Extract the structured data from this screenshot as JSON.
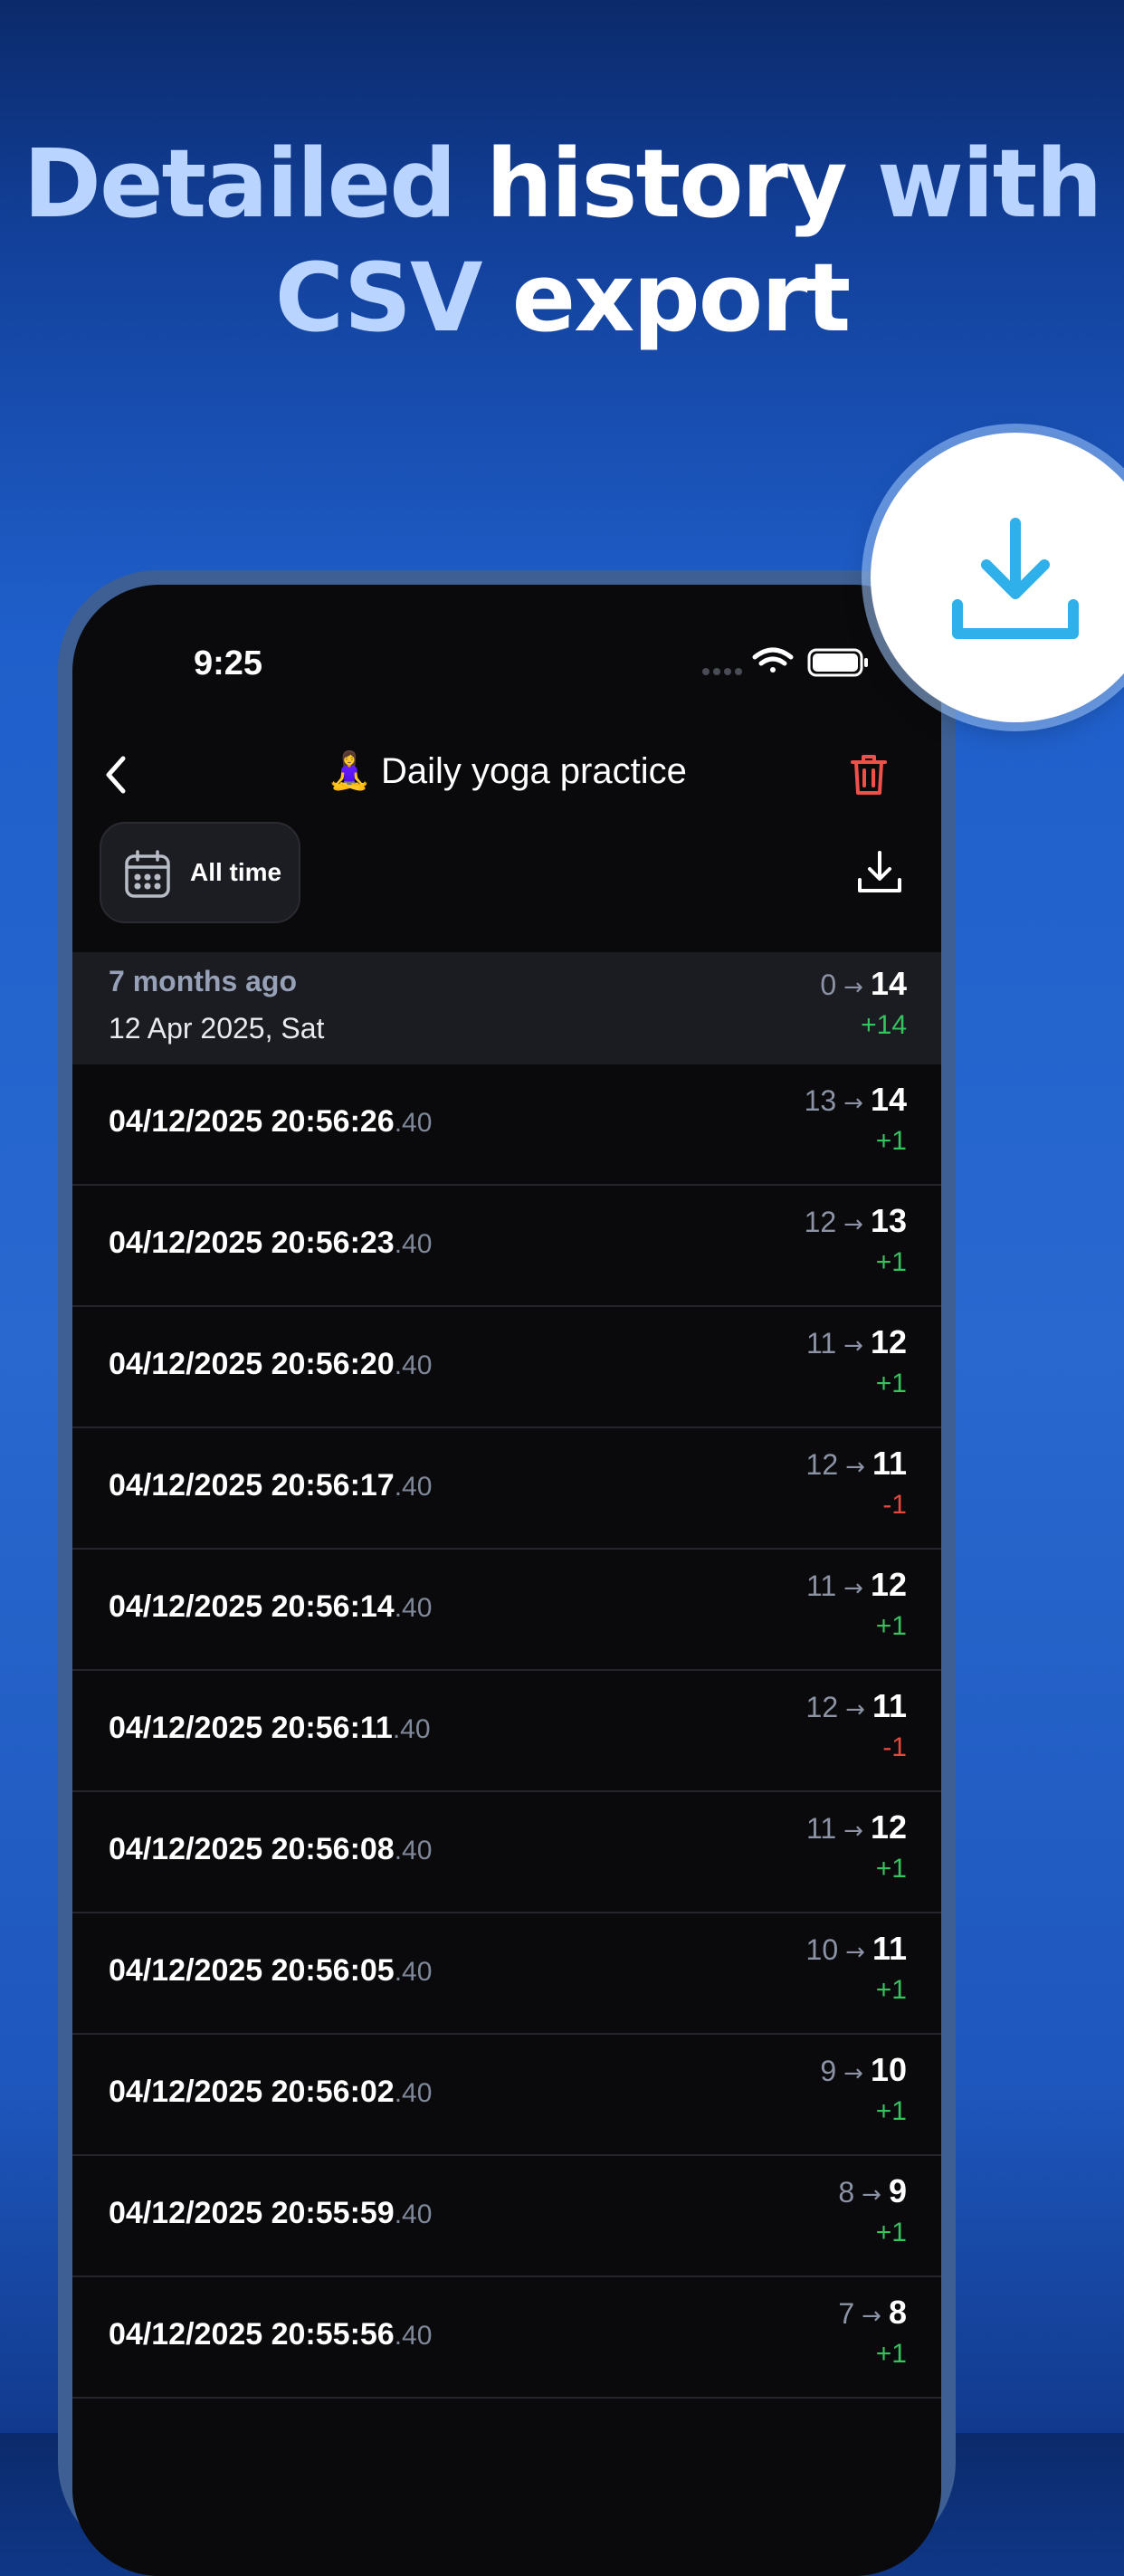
{
  "headline": {
    "line1_light": "Detailed ",
    "line1_white": "history",
    "line1_light2": " with",
    "line2_light": "CSV",
    "line2_white": " export"
  },
  "status_bar": {
    "time": "9:25"
  },
  "nav": {
    "title_emoji": "🧘‍♀️",
    "title": "Daily yoga practice"
  },
  "filter": {
    "range_label": "All time"
  },
  "group": {
    "relative": "7 months ago",
    "date": "12 Apr 2025, Sat",
    "from": "0",
    "to": "14",
    "delta": "+14"
  },
  "arrow": "→",
  "rows": [
    {
      "time": "04/12/2025 20:56:26",
      "ms": ".40",
      "from": "13",
      "to": "14",
      "delta": "+1"
    },
    {
      "time": "04/12/2025 20:56:23",
      "ms": ".40",
      "from": "12",
      "to": "13",
      "delta": "+1"
    },
    {
      "time": "04/12/2025 20:56:20",
      "ms": ".40",
      "from": "11",
      "to": "12",
      "delta": "+1"
    },
    {
      "time": "04/12/2025 20:56:17",
      "ms": ".40",
      "from": "12",
      "to": "11",
      "delta": "-1"
    },
    {
      "time": "04/12/2025 20:56:14",
      "ms": ".40",
      "from": "11",
      "to": "12",
      "delta": "+1"
    },
    {
      "time": "04/12/2025 20:56:11",
      "ms": ".40",
      "from": "12",
      "to": "11",
      "delta": "-1"
    },
    {
      "time": "04/12/2025 20:56:08",
      "ms": ".40",
      "from": "11",
      "to": "12",
      "delta": "+1"
    },
    {
      "time": "04/12/2025 20:56:05",
      "ms": ".40",
      "from": "10",
      "to": "11",
      "delta": "+1"
    },
    {
      "time": "04/12/2025 20:56:02",
      "ms": ".40",
      "from": "9",
      "to": "10",
      "delta": "+1"
    },
    {
      "time": "04/12/2025 20:55:59",
      "ms": ".40",
      "from": "8",
      "to": "9",
      "delta": "+1"
    },
    {
      "time": "04/12/2025 20:55:56",
      "ms": ".40",
      "from": "7",
      "to": "8",
      "delta": "+1"
    }
  ],
  "colors": {
    "positive": "#36c35d",
    "negative": "#e5483e",
    "accent": "#2fb0ea",
    "trash": "#f0504a"
  },
  "icons": {
    "back": "chevron-left-icon",
    "trash": "trash-icon",
    "calendar": "calendar-icon",
    "export": "download-icon",
    "badge": "download-icon"
  }
}
